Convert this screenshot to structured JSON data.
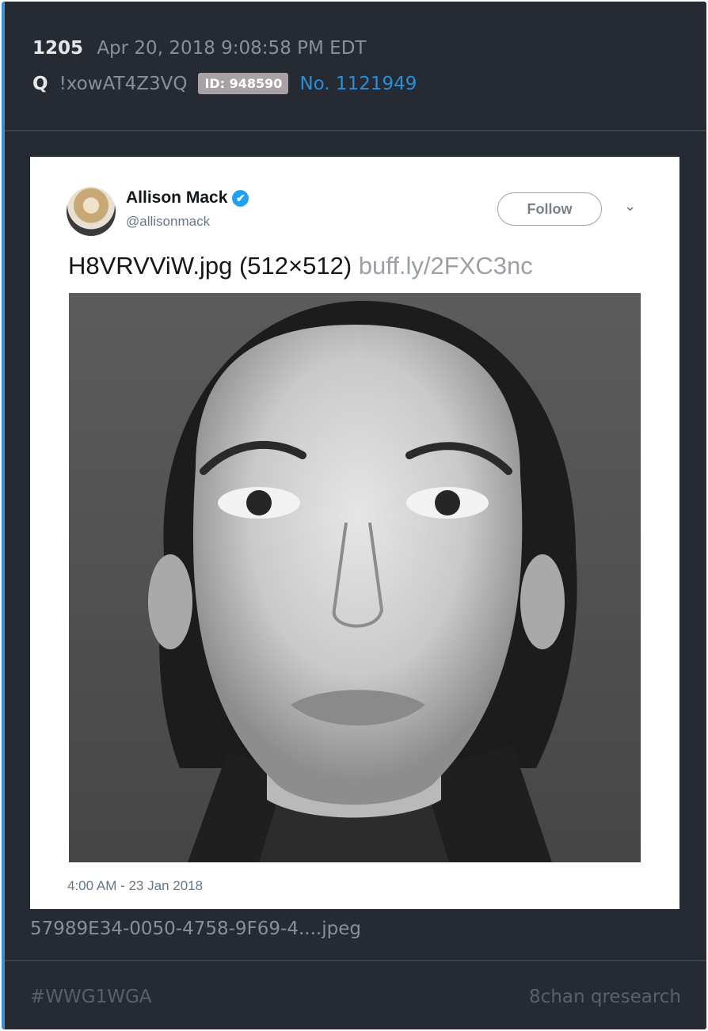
{
  "post": {
    "number": "1205",
    "datetime": "Apr 20, 2018 9:08:58 PM EDT",
    "author": "Q",
    "tripcode": "!xowAT4Z3VQ",
    "id_badge": "ID: 948590",
    "post_no": "No. 1121949"
  },
  "tweet": {
    "name": "Allison Mack",
    "verified_icon": "✔",
    "handle": "@allisonmack",
    "follow_label": "Follow",
    "caret": "⌄",
    "text": "H8VRVViW.jpg (512×512)",
    "link": "buff.ly/2FXC3nc",
    "timestamp": "4:00 AM - 23 Jan 2018"
  },
  "attachment": {
    "filename": "57989E34-0050-4758-9F69-4....jpeg"
  },
  "footer": {
    "hashtag": "#WWG1WGA",
    "source": "8chan qresearch"
  },
  "colors": {
    "background": "#262b33",
    "accent": "#3f8fd8",
    "post_link": "#2a8fd8",
    "id_badge": "#a8a2a7",
    "twitter_verified": "#1da1f2"
  }
}
